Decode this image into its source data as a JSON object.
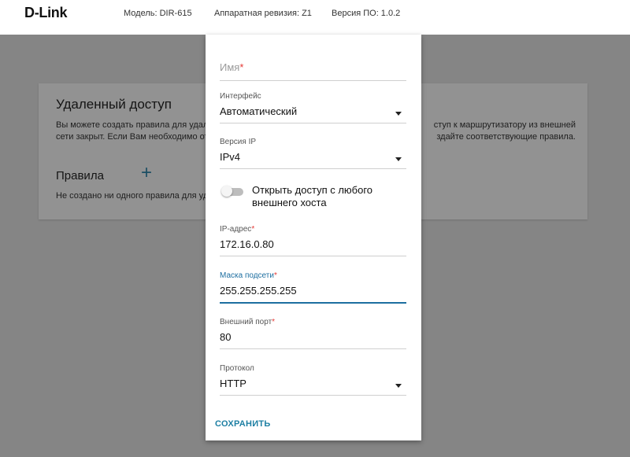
{
  "header": {
    "logo": "D-Link",
    "model": "Модель: DIR-615",
    "hw_revision": "Аппаратная ревизия: Z1",
    "fw_version": "Версия ПО: 1.0.2"
  },
  "background": {
    "title": "Удаленный доступ",
    "desc_left_1": "Вы можете создать правила для удал",
    "desc_right_1": "ступ к маршрутизатору из внешней",
    "desc_left_2": "сети закрыт. Если Вам необходимо от",
    "desc_right_2": "здайте соответствующие правила.",
    "rules_title": "Правила",
    "add_icon": "+",
    "empty_text": "Не создано ни одного правила для уд"
  },
  "modal": {
    "name_placeholder": "Имя",
    "required_mark": "*",
    "interface_label": "Интерфейс",
    "interface_value": "Автоматический",
    "ip_version_label": "Версия IP",
    "ip_version_value": "IPv4",
    "open_access_label": "Открыть доступ с любого внешнего хоста",
    "open_access_enabled": false,
    "ip_label": "IP-адрес",
    "ip_value": "172.16.0.80",
    "mask_label": "Маска подсети",
    "mask_value": "255.255.255.255",
    "port_label": "Внешний порт",
    "port_value": "80",
    "protocol_label": "Протокол",
    "protocol_value": "HTTP",
    "save_label": "СОХРАНИТЬ"
  },
  "colors": {
    "accent": "#1d6ea0",
    "save_text": "#1d7fa3",
    "required": "#e53935",
    "overlay": "#858585"
  }
}
